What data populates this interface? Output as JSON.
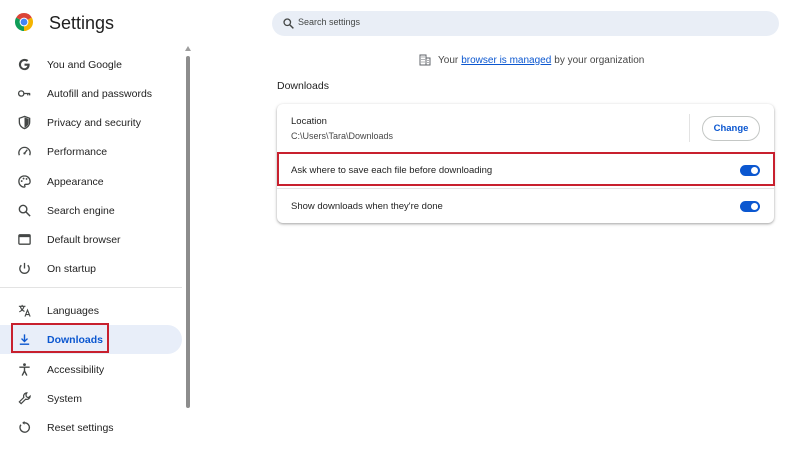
{
  "app": {
    "title": "Settings"
  },
  "sidebar": {
    "items": [
      {
        "label": "You and Google",
        "icon": "google-g-icon"
      },
      {
        "label": "Autofill and passwords",
        "icon": "key-icon"
      },
      {
        "label": "Privacy and security",
        "icon": "shield-icon"
      },
      {
        "label": "Performance",
        "icon": "speedometer-icon"
      },
      {
        "label": "Appearance",
        "icon": "palette-icon"
      },
      {
        "label": "Search engine",
        "icon": "search-icon"
      },
      {
        "label": "Default browser",
        "icon": "browser-window-icon"
      },
      {
        "label": "On startup",
        "icon": "power-icon"
      },
      {
        "label": "Languages",
        "icon": "translate-icon"
      },
      {
        "label": "Downloads",
        "icon": "download-icon",
        "active": true
      },
      {
        "label": "Accessibility",
        "icon": "accessibility-icon"
      },
      {
        "label": "System",
        "icon": "wrench-icon"
      },
      {
        "label": "Reset settings",
        "icon": "reset-icon"
      }
    ]
  },
  "search": {
    "placeholder": "Search settings"
  },
  "managed_notice": {
    "prefix": "Your",
    "link": "browser is managed",
    "suffix": "by your organization"
  },
  "downloads": {
    "section_title": "Downloads",
    "location_label": "Location",
    "location_value": "C:\\Users\\Tara\\Downloads",
    "change_button": "Change",
    "ask_where_label": "Ask where to save each file before downloading",
    "ask_where_enabled": true,
    "show_when_done_label": "Show downloads when they're done",
    "show_when_done_enabled": true
  },
  "colors": {
    "accent": "#0b57d0",
    "active_nav_bg": "#e8eef9",
    "search_bg": "#e9eef6",
    "highlight_box": "#c8202e"
  }
}
